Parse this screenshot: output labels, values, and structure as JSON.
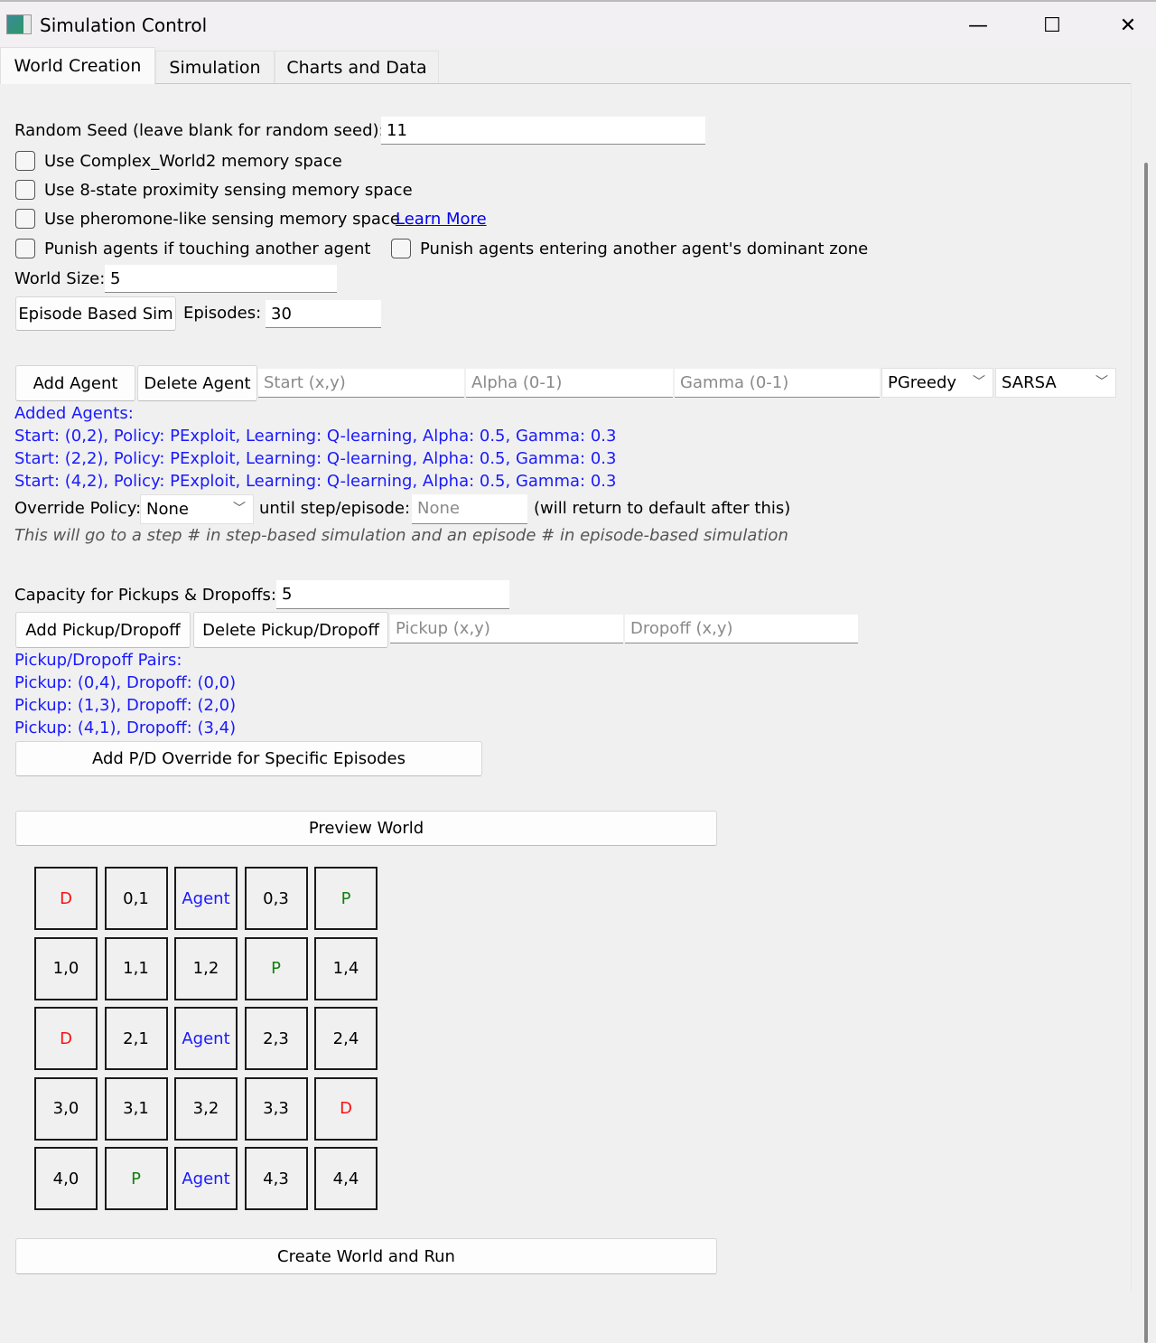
{
  "window": {
    "title": "Simulation Control",
    "controls": {
      "minimize": "—",
      "maximize": "☐",
      "close": "✕"
    }
  },
  "tabs": [
    {
      "label": "World Creation",
      "active": true
    },
    {
      "label": "Simulation",
      "active": false
    },
    {
      "label": "Charts and Data",
      "active": false
    }
  ],
  "seed": {
    "label": "Random Seed (leave blank for random seed):",
    "value": "11"
  },
  "checkboxes": [
    {
      "label": "Use Complex_World2 memory space",
      "checked": false
    },
    {
      "label": "Use 8-state proximity sensing memory space",
      "checked": false
    },
    {
      "label": "Use pheromone-like sensing memory space",
      "checked": false
    },
    {
      "label": "Punish agents if touching another agent",
      "checked": false
    },
    {
      "label": "Punish agents entering another agent's dominant zone",
      "checked": false
    }
  ],
  "learn_more": "Learn More",
  "world_size": {
    "label": "World Size:",
    "value": "5"
  },
  "episode": {
    "button": "Episode Based Sim",
    "label": "Episodes:",
    "value": "30"
  },
  "agents": {
    "add_button": "Add Agent",
    "delete_button": "Delete Agent",
    "start_placeholder": "Start (x,y)",
    "alpha_placeholder": "Alpha (0-1)",
    "gamma_placeholder": "Gamma (0-1)",
    "policy_selected": "PGreedy",
    "learning_selected": "SARSA",
    "list_header": "Added Agents:",
    "list": [
      "Start: (0,2), Policy: PExploit, Learning: Q-learning, Alpha: 0.5, Gamma: 0.3",
      "Start: (2,2), Policy: PExploit, Learning: Q-learning, Alpha: 0.5, Gamma: 0.3",
      "Start: (4,2), Policy: PExploit, Learning: Q-learning, Alpha: 0.5, Gamma: 0.3"
    ]
  },
  "override": {
    "label": "Override Policy:",
    "selected": "None",
    "until_label": "until step/episode:",
    "until_placeholder": "None",
    "note": "(will return to default after this)",
    "hint": "This will go to a step # in step-based simulation and an episode # in episode-based simulation"
  },
  "capacity": {
    "label": "Capacity for Pickups & Dropoffs:",
    "value": "5"
  },
  "pd": {
    "add_button": "Add Pickup/Dropoff",
    "delete_button": "Delete Pickup/Dropoff",
    "pickup_placeholder": "Pickup (x,y)",
    "dropoff_placeholder": "Dropoff (x,y)",
    "list_header": "Pickup/Dropoff Pairs:",
    "list": [
      "Pickup: (0,4), Dropoff: (0,0)",
      "Pickup: (1,3), Dropoff: (2,0)",
      "Pickup: (4,1), Dropoff: (3,4)"
    ],
    "override_button": "Add P/D Override for Specific Episodes"
  },
  "preview_button": "Preview World",
  "grid": [
    [
      "D",
      "0,1",
      "Agent",
      "0,3",
      "P"
    ],
    [
      "1,0",
      "1,1",
      "1,2",
      "P",
      "1,4"
    ],
    [
      "D",
      "2,1",
      "Agent",
      "2,3",
      "2,4"
    ],
    [
      "3,0",
      "3,1",
      "3,2",
      "3,3",
      "D"
    ],
    [
      "4,0",
      "P",
      "Agent",
      "4,3",
      "4,4"
    ]
  ],
  "create_button": "Create World and Run"
}
